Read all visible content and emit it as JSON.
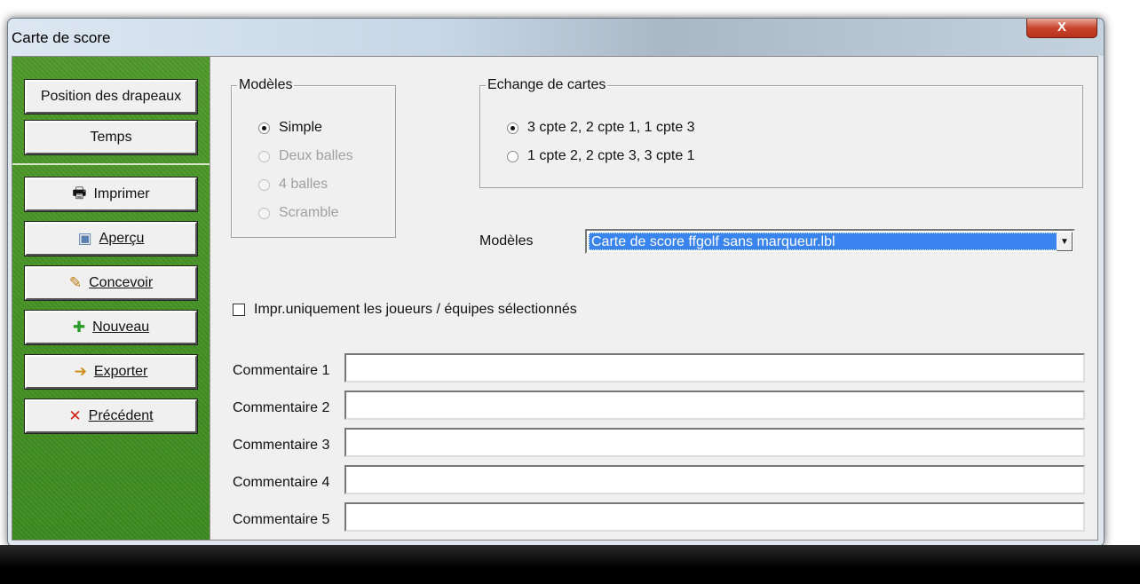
{
  "window": {
    "title": "Carte de score",
    "close_glyph": "X"
  },
  "sidebar": {
    "buttons": [
      {
        "label": "Position des drapeaux",
        "icon": ""
      },
      {
        "label": "Temps",
        "icon": ""
      },
      {
        "label": "Imprimer",
        "icon": "printer-icon"
      },
      {
        "label": "Aperçu",
        "icon": "preview-icon"
      },
      {
        "label": "Concevoir",
        "icon": "design-icon"
      },
      {
        "label": "Nouveau",
        "icon": "new-icon"
      },
      {
        "label": "Exporter",
        "icon": "export-icon"
      },
      {
        "label": "Précédent",
        "icon": "close-icon"
      }
    ]
  },
  "modeles_group": {
    "title": "Modèles",
    "options": [
      {
        "label": "Simple",
        "selected": true,
        "enabled": true
      },
      {
        "label": "Deux balles",
        "selected": false,
        "enabled": false
      },
      {
        "label": "4 balles",
        "selected": false,
        "enabled": false
      },
      {
        "label": "Scramble",
        "selected": false,
        "enabled": false
      }
    ]
  },
  "echange_group": {
    "title": "Echange de cartes",
    "options": [
      {
        "label": "3 cpte 2, 2 cpte 1, 1 cpte 3",
        "selected": true
      },
      {
        "label": "1 cpte 2, 2 cpte 3, 3 cpte 1",
        "selected": false
      }
    ]
  },
  "modeles_select": {
    "label": "Modèles",
    "value": "Carte de score ffgolf sans marqueur.lbl"
  },
  "checkbox": {
    "label": "Impr.uniquement les joueurs / équipes sélectionnés",
    "checked": false
  },
  "comments": [
    {
      "label": "Commentaire 1",
      "value": ""
    },
    {
      "label": "Commentaire 2",
      "value": ""
    },
    {
      "label": "Commentaire 3",
      "value": ""
    },
    {
      "label": "Commentaire 4",
      "value": ""
    },
    {
      "label": "Commentaire 5",
      "value": ""
    }
  ],
  "colors": {
    "sidebar_green": "#4a9628",
    "selection_blue": "#3a84f0",
    "close_red": "#c8452c"
  }
}
